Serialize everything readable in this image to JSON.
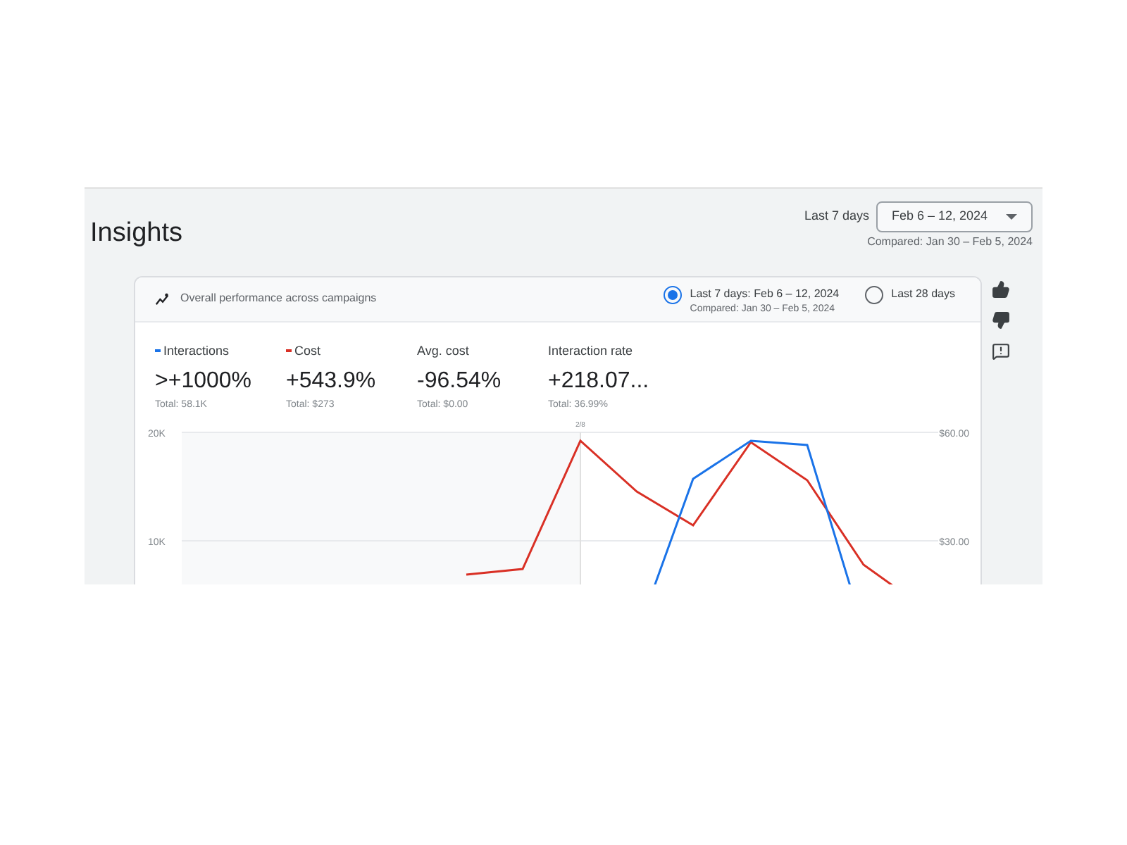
{
  "header": {
    "title": "Insights",
    "period_label": "Last 7 days",
    "date_range": {
      "value": "Feb 6 – 12, 2024",
      "expanded": false
    },
    "compared": "Compared: Jan 30 – Feb 5, 2024"
  },
  "card": {
    "title": "Overall performance across campaigns",
    "periods": [
      {
        "label": "Last 7 days: Feb 6 – 12, 2024",
        "sublabel": "Compared: Jan 30 – Feb 5, 2024",
        "selected": true
      },
      {
        "label": "Last 28 days",
        "selected": false
      }
    ],
    "metrics": [
      {
        "label": "Interactions",
        "value": ">+1000%",
        "total": "Total: 58.1K",
        "color": "#1a73e8"
      },
      {
        "label": "Cost",
        "value": "+543.9%",
        "total": "Total: $273",
        "color": "#d93025"
      },
      {
        "label": "Avg. cost",
        "value": "-96.54%",
        "total": "Total: $0.00"
      },
      {
        "label": "Interaction rate",
        "value": "+218.07...",
        "total": "Total: 36.99%"
      }
    ],
    "chart": {
      "marker_label": "2/8",
      "left_ticks": [
        "20K",
        "10K"
      ],
      "right_ticks": [
        "$60.00",
        "$30.00"
      ]
    }
  }
}
